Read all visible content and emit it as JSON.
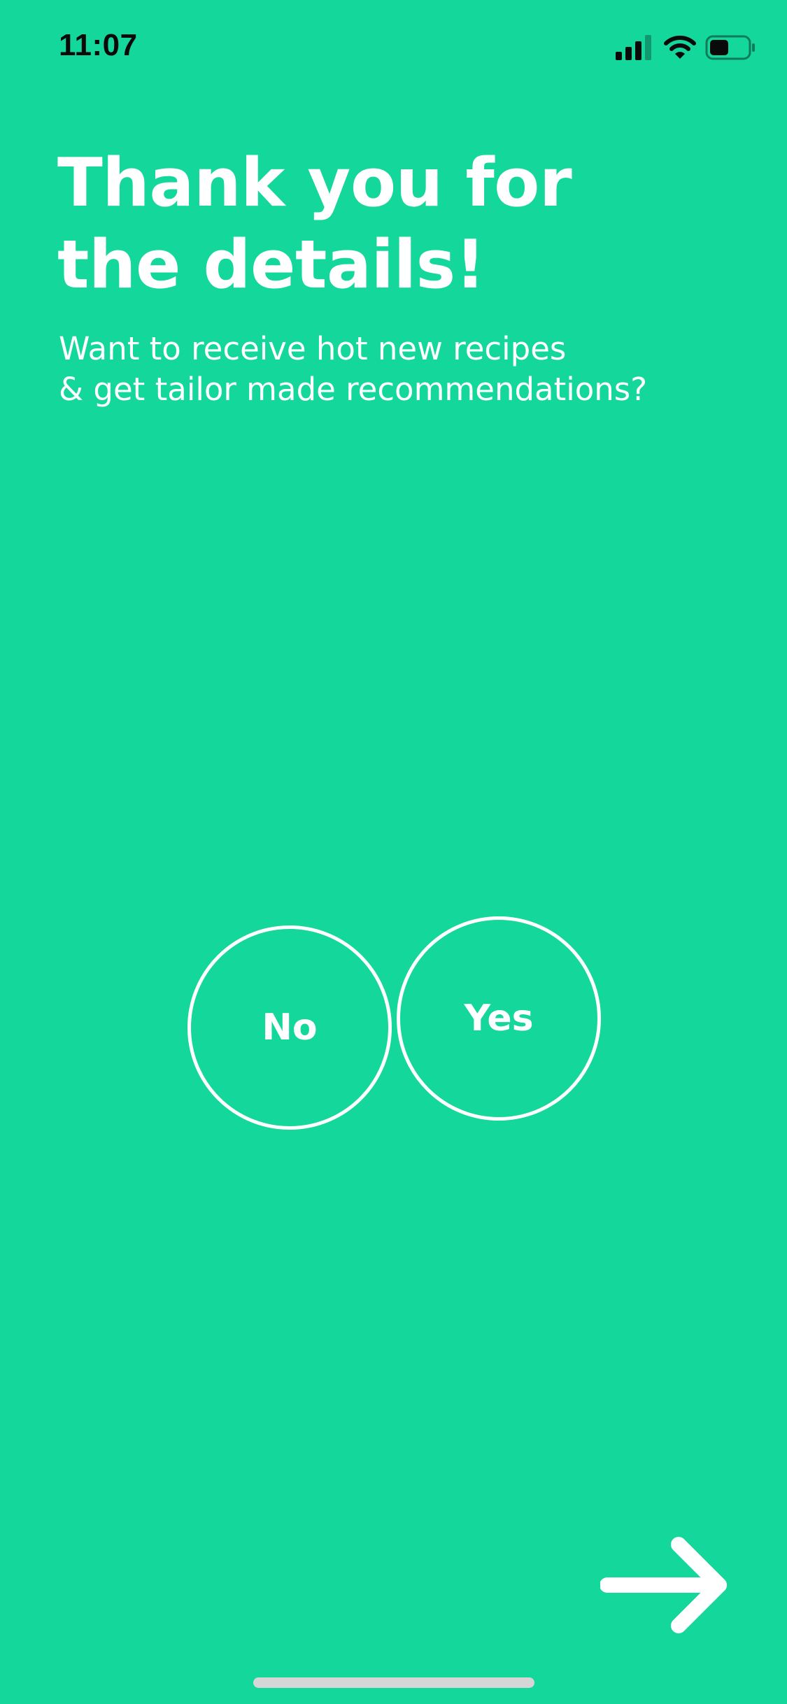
{
  "status_bar": {
    "time": "11:07",
    "icons": [
      "signal-icon",
      "wifi-icon",
      "battery-icon"
    ],
    "battery_level": 0.5
  },
  "headline": {
    "line1": "Thank you for",
    "line2": "the details!"
  },
  "subtext": {
    "line1": "Want to receive hot new recipes",
    "line2": "& get tailor made recommendations?"
  },
  "choices": {
    "no_label": "No",
    "yes_label": "Yes"
  },
  "navigation": {
    "next_icon": "arrow-right-icon"
  },
  "colors": {
    "background": "#14d79b",
    "foreground": "#ffffff",
    "status_text": "#0a0a0a",
    "home_indicator": "#d6d6d6"
  }
}
